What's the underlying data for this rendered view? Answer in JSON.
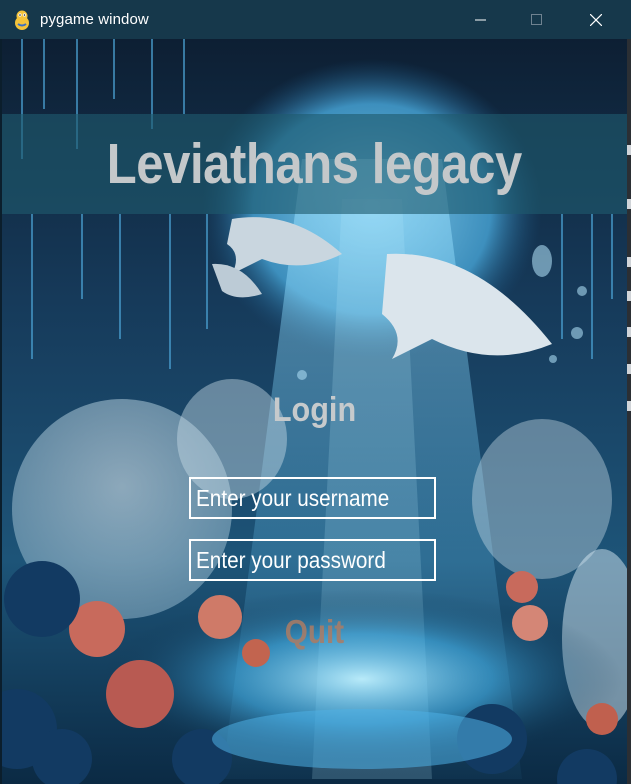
{
  "window": {
    "title": "pygame window",
    "app_icon": "pygame-snake-icon",
    "controls": [
      "minimize-icon",
      "maximize-icon",
      "close-icon"
    ]
  },
  "game": {
    "title": "Leviathans legacy",
    "login_heading": "Login",
    "username_placeholder": "Enter your username",
    "password_placeholder": "Enter your password",
    "quit_label": "Quit"
  },
  "colors": {
    "titlebar": "#16384b",
    "banner": "#1e5a6e",
    "title_text": "#c4c8ca",
    "field_border": "#ffffff",
    "quit_text": "#ad7c64"
  }
}
